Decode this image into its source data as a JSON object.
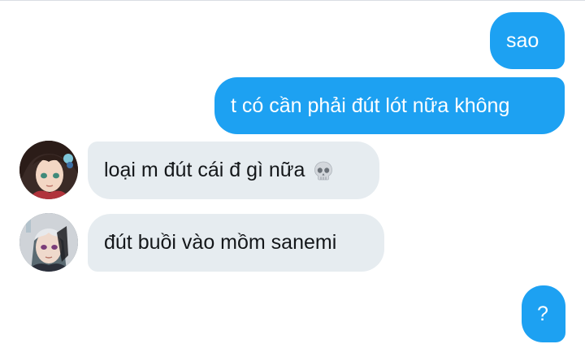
{
  "messages": [
    {
      "sender": "me",
      "text": "sao"
    },
    {
      "sender": "me",
      "text": "t có cần phải đút lót nữa không"
    },
    {
      "sender": "contact",
      "avatar": "avatar-girl-dark-hair",
      "text": "loại m đút cái đ gì nữa",
      "emoji": "skull-icon"
    },
    {
      "sender": "contact",
      "avatar": "avatar-boy-white-hair",
      "text": "đút buồi vào mồm sanemi"
    },
    {
      "sender": "me",
      "text": "?"
    }
  ],
  "colors": {
    "outgoing_bubble": "#1da1f2",
    "outgoing_text": "#ffffff",
    "incoming_bubble": "#e6ecf0",
    "incoming_text": "#14171a"
  }
}
